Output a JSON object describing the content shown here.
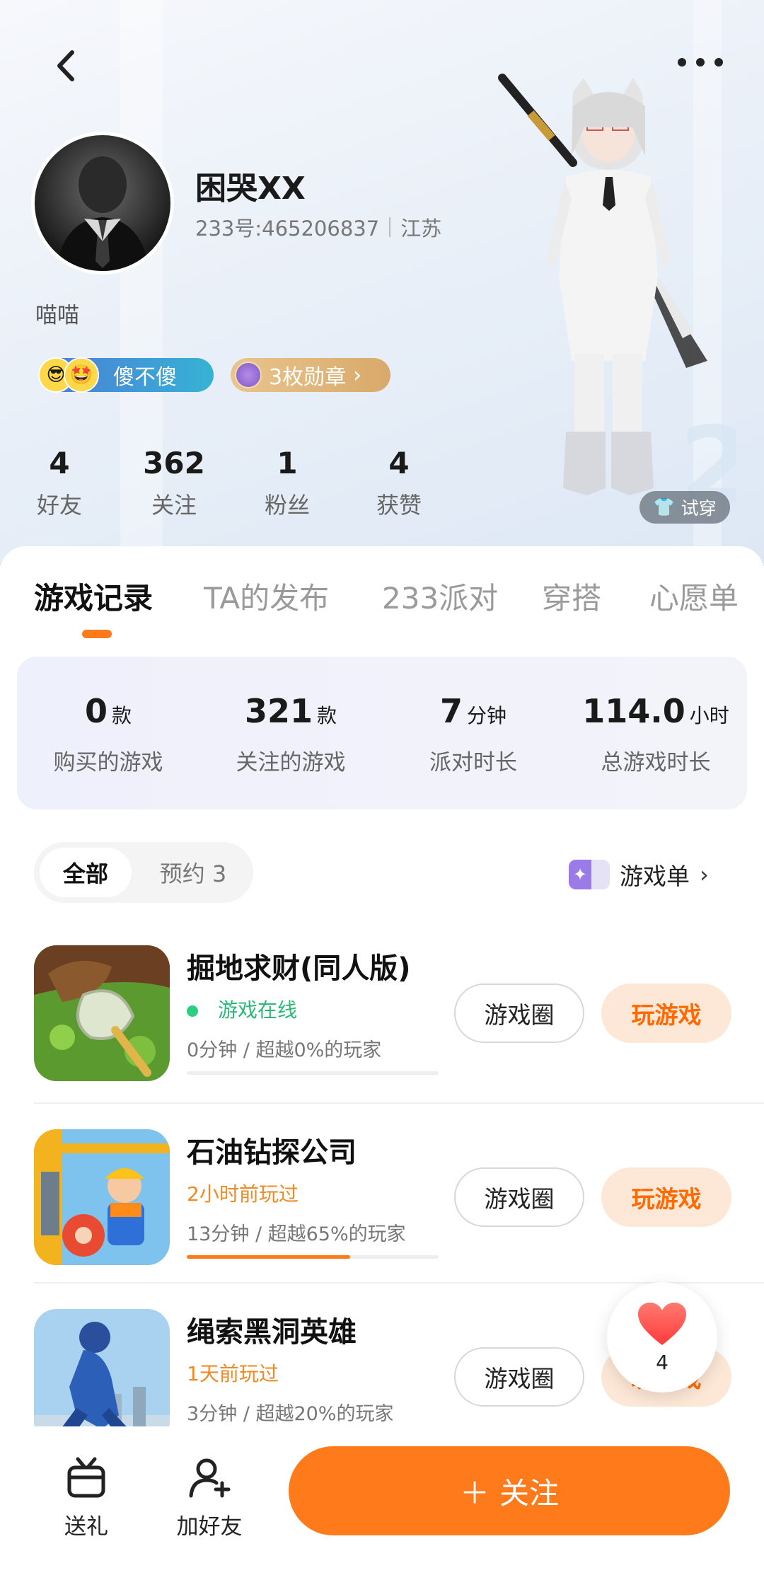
{
  "profile": {
    "name": "困哭XX",
    "id_text": "233号:465206837",
    "location": "江苏",
    "bio": "喵喵",
    "badges": {
      "title_label": "傻不傻",
      "medals_label": "3枚勋章"
    },
    "stats": [
      {
        "num": "4",
        "label": "好友"
      },
      {
        "num": "362",
        "label": "关注"
      },
      {
        "num": "1",
        "label": "粉丝"
      },
      {
        "num": "4",
        "label": "获赞"
      }
    ],
    "try_on_label": "试穿"
  },
  "tabs": [
    "游戏记录",
    "TA的发布",
    "233派对",
    "穿搭",
    "心愿单"
  ],
  "summary": [
    {
      "value": "0",
      "unit": "款",
      "label": "购买的游戏"
    },
    {
      "value": "321",
      "unit": "款",
      "label": "关注的游戏"
    },
    {
      "value": "7",
      "unit": "分钟",
      "label": "派对时长"
    },
    {
      "value": "114.0",
      "unit": "小时",
      "label": "总游戏时长"
    }
  ],
  "filter": {
    "all": "全部",
    "reserved": "预约 3"
  },
  "game_list_link": "游戏单",
  "games": [
    {
      "title": "掘地求财(同人版)",
      "status": "游戏在线",
      "status_color": "#2cb877",
      "meta": "0分钟 / 超越0%的玩家",
      "progress": 0,
      "circle_label": "游戏圈",
      "play_label": "玩游戏"
    },
    {
      "title": "石油钻探公司",
      "status": "2小时前玩过",
      "status_color": "#f08a24",
      "meta": "13分钟 / 超越65%的玩家",
      "progress": 0.65,
      "circle_label": "游戏圈",
      "play_label": "玩游戏"
    },
    {
      "title": "绳索黑洞英雄",
      "status": "1天前玩过",
      "status_color": "#f08a24",
      "meta": "3分钟 / 超越20%的玩家",
      "progress": 0.2,
      "circle_label": "游戏圈",
      "play_label": "玩游戏"
    }
  ],
  "like_count": "4",
  "bottom": {
    "gift": "送礼",
    "add_friend": "加好友",
    "follow": "关注"
  },
  "colors": {
    "accent": "#ff7a1a",
    "play_bg": "#fde7d6"
  }
}
